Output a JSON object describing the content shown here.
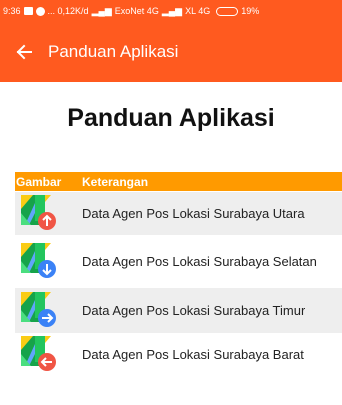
{
  "status_bar": {
    "time": "9:36",
    "speed": "... 0,12K/d",
    "carrier1": "ExoNet 4G",
    "carrier2": "XL 4G",
    "battery": "19%"
  },
  "app_bar": {
    "title": "Panduan Aplikasi"
  },
  "page": {
    "heading": "Panduan Aplikasi"
  },
  "table": {
    "header": {
      "gambar": "Gambar",
      "keterangan": "Keterangan"
    },
    "rows": [
      {
        "icon": "maps-arrow-up-red-icon",
        "badge_color": "#f05545",
        "direction": "up",
        "text": "Data Agen Pos Lokasi Surabaya Utara"
      },
      {
        "icon": "maps-arrow-down-blue-icon",
        "badge_color": "#3b82f6",
        "direction": "down",
        "text": "Data Agen Pos Lokasi Surabaya Selatan"
      },
      {
        "icon": "maps-arrow-right-blue-icon",
        "badge_color": "#3b82f6",
        "direction": "right",
        "text": "Data Agen Pos Lokasi Surabaya Timur"
      },
      {
        "icon": "maps-arrow-left-red-icon",
        "badge_color": "#f05545",
        "direction": "left",
        "text": "Data Agen Pos Lokasi Surabaya Barat"
      }
    ]
  },
  "colors": {
    "primary": "#ff5a1f",
    "table_header": "#ff9a00"
  }
}
